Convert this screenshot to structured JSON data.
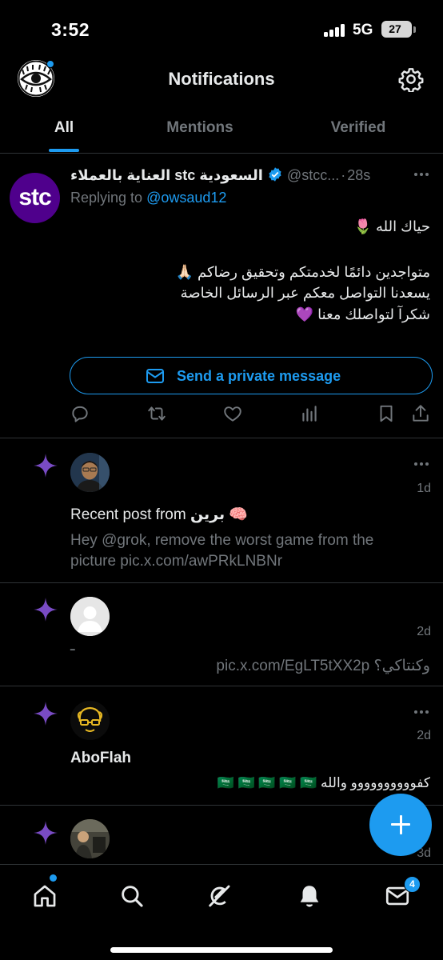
{
  "status_bar": {
    "time": "3:52",
    "network": "5G",
    "battery_level": "27"
  },
  "header": {
    "title": "Notifications",
    "avatar_icon": "eye-logo-icon",
    "settings_icon": "gear-icon"
  },
  "tabs": [
    {
      "label": "All",
      "active": true
    },
    {
      "label": "Mentions",
      "active": false
    },
    {
      "label": "Verified",
      "active": false
    }
  ],
  "reply": {
    "avatar_text": "stc",
    "avatar_color": "#4f008c",
    "display_name": "العناية بالعملاء stc السعودية",
    "handle": "@stcc...",
    "separator": "·",
    "time": "28s",
    "replying_prefix": "Replying to ",
    "replying_to": "@owsaud12",
    "line1": "حياك الله 🌷",
    "line2": "متواجدين دائمًا لخدمتكم وتحقيق رضاكم 🙏🏻",
    "line3": "يسعدنا التواصل معكم عبر الرسائل الخاصة",
    "line4": "شكرآ لتواصلك معنا 💜",
    "dm_button_label": "Send a private message",
    "actions": [
      "reply-icon",
      "retweet-icon",
      "like-icon",
      "views-icon",
      "bookmark-icon",
      "share-icon"
    ]
  },
  "notifications": [
    {
      "time": "1d",
      "title_prefix": "Recent post from ",
      "title_name": "برين 🧠",
      "body": "Hey @grok, remove the worst game from the picture pic.x.com/awPRkLNBNr"
    },
    {
      "time": "2d",
      "small_mark": "ـ",
      "body": "وكنتاكي؟ pic.x.com/EgLT5tXX2p"
    },
    {
      "time": "2d",
      "name": "AboFlah",
      "body": "كفوووووووووو والله 🇸🇦 🇸🇦 🇸🇦 🇸🇦 🇸🇦"
    },
    {
      "time": "3d"
    }
  ],
  "fab": {
    "icon": "plus-icon"
  },
  "bottom_nav": {
    "items": [
      "home-icon",
      "search-icon",
      "grok-icon",
      "bell-icon",
      "mail-icon"
    ],
    "mail_badge": "4"
  },
  "colors": {
    "accent": "#1d9bf0",
    "sparkle": "#794bc4",
    "background": "#000000"
  }
}
